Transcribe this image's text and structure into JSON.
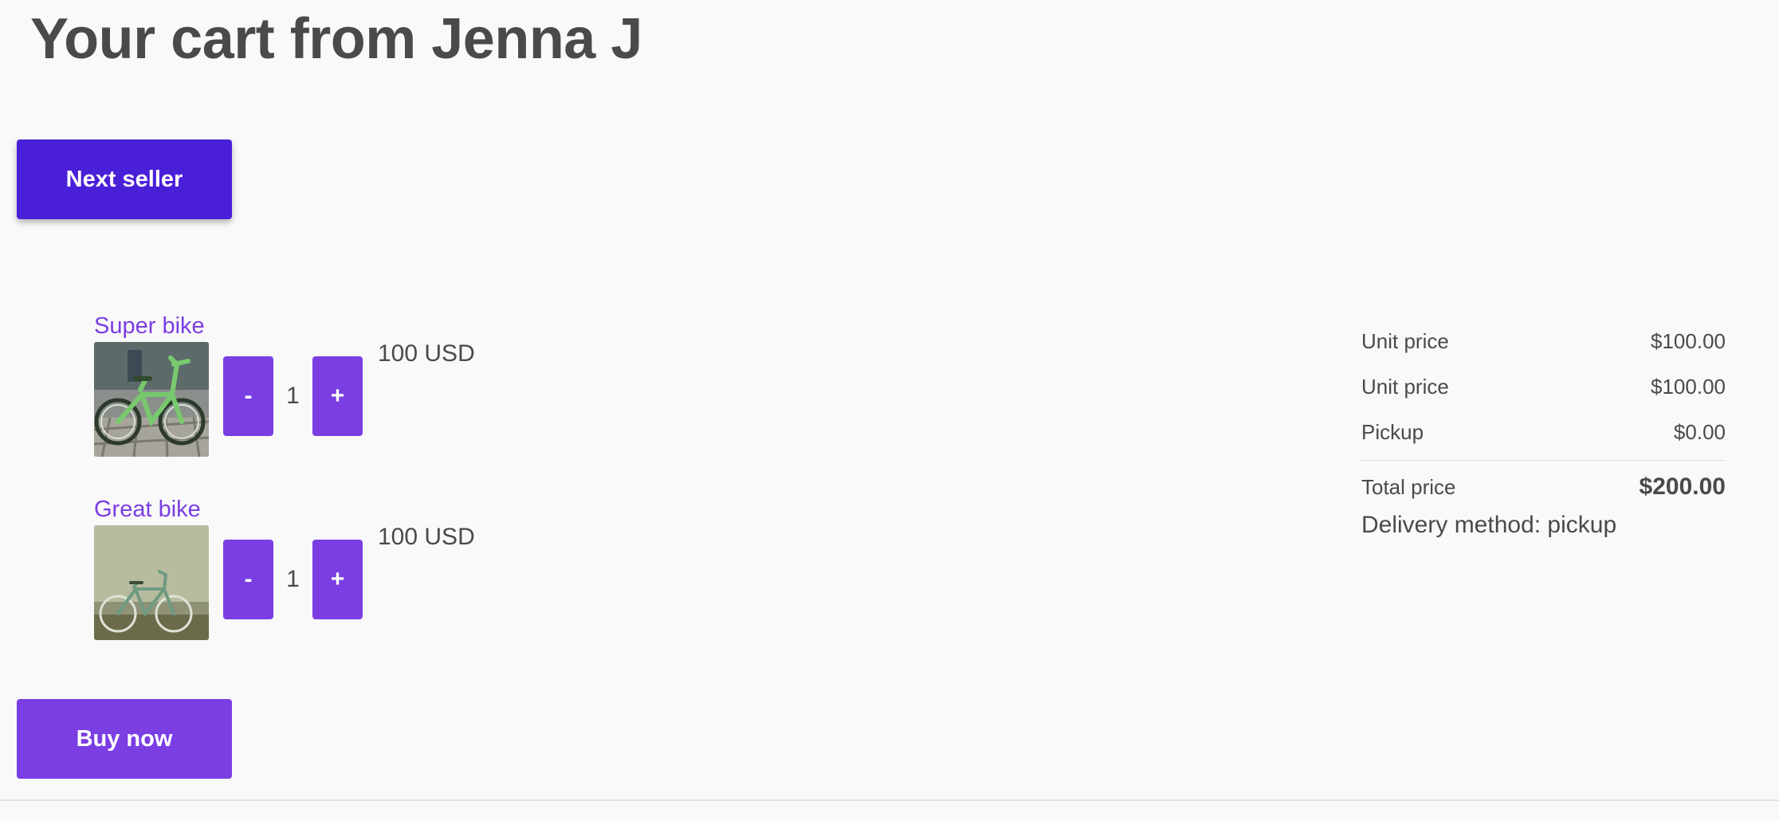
{
  "header": {
    "title": "Your cart from Jenna J"
  },
  "actions": {
    "next_seller_label": "Next seller",
    "buy_now_label": "Buy now"
  },
  "theme": {
    "primary": "#7a3ee3",
    "primary_dark": "#4a1fd8",
    "background": "#f9f9f9"
  },
  "cart": {
    "items": [
      {
        "title": "Super bike",
        "image_icon": "green-bicycle-photo",
        "decrement_label": "-",
        "quantity": "1",
        "increment_label": "+",
        "price": "100 USD"
      },
      {
        "title": "Great bike",
        "image_icon": "bicycle-against-wall-photo",
        "decrement_label": "-",
        "quantity": "1",
        "increment_label": "+",
        "price": "100 USD"
      }
    ]
  },
  "summary": {
    "lines": [
      {
        "label": "Unit price",
        "value": "$100.00"
      },
      {
        "label": "Unit price",
        "value": "$100.00"
      },
      {
        "label": "Pickup",
        "value": "$0.00"
      }
    ],
    "total_label": "Total price",
    "total_value": "$200.00",
    "delivery_text": "Delivery method: pickup"
  }
}
